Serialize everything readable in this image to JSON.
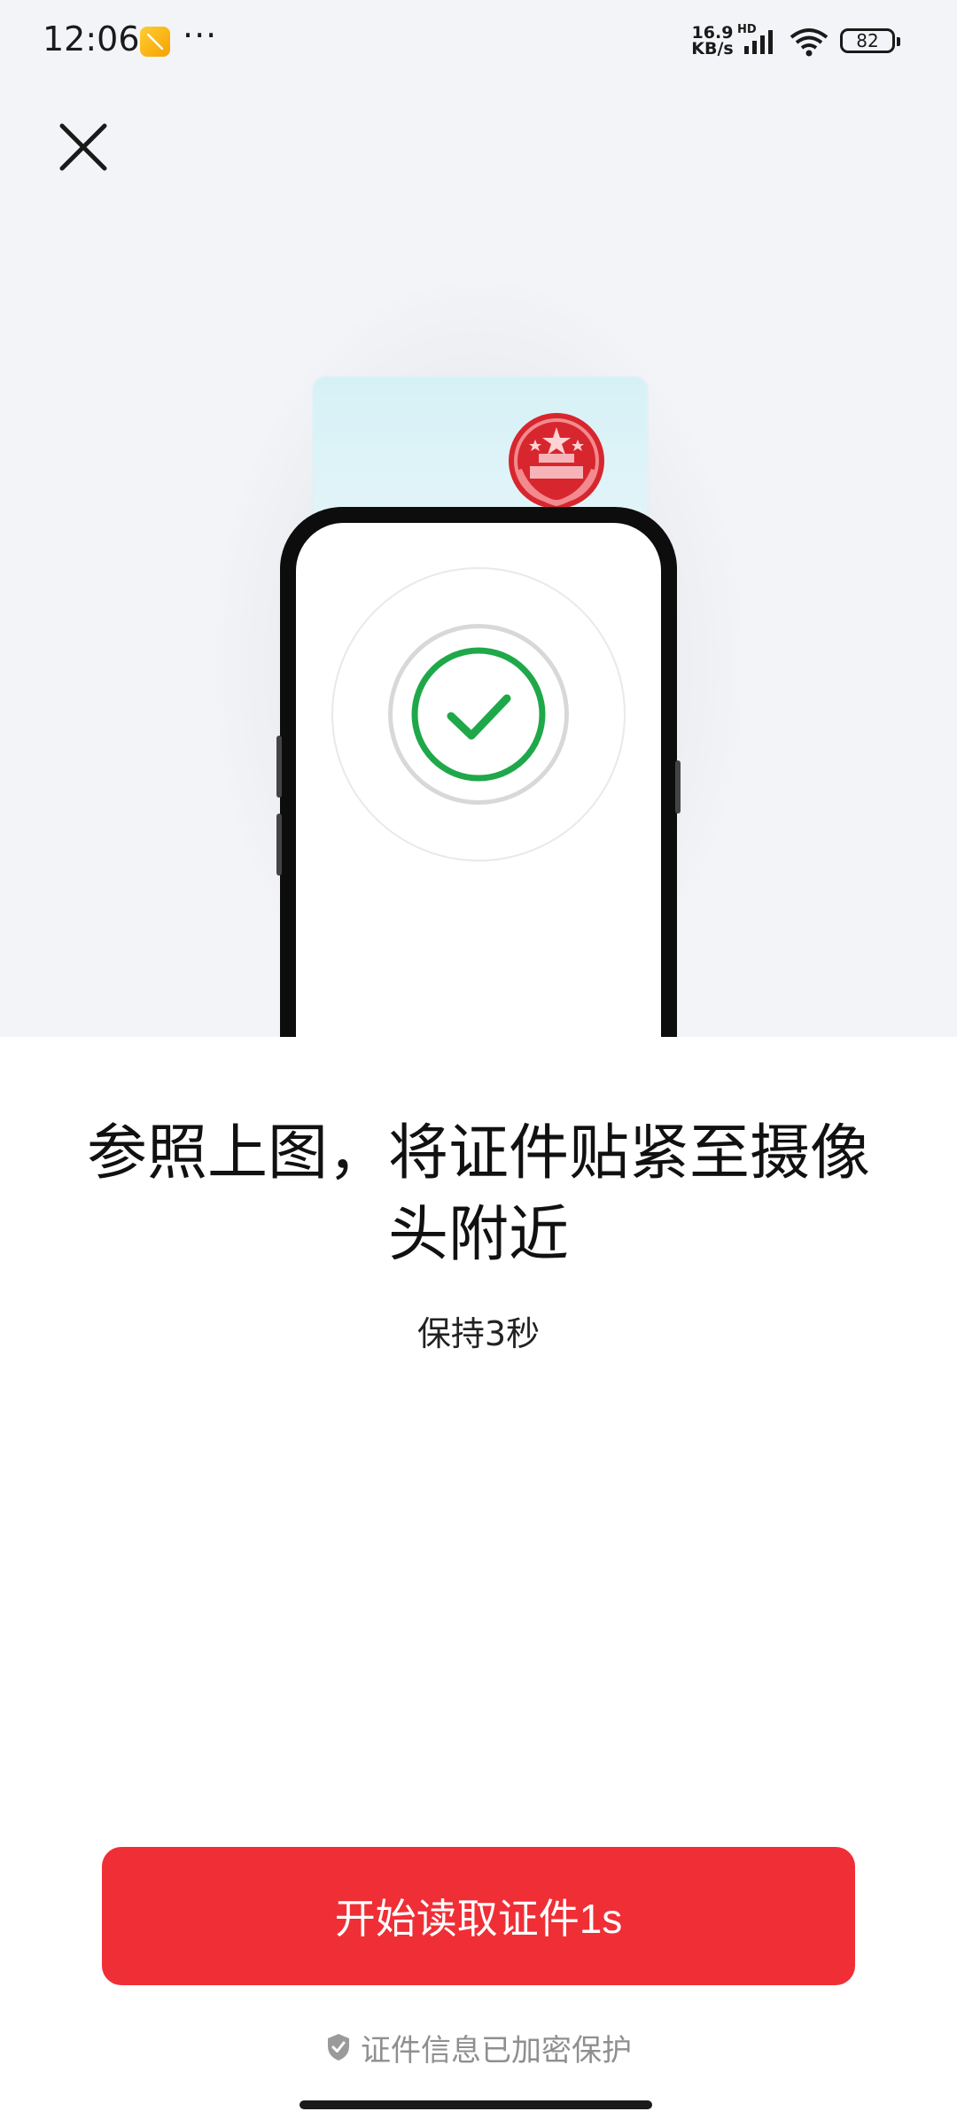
{
  "status_bar": {
    "time": "12:06",
    "more": "···",
    "net_speed": "16.9",
    "net_unit": "KB/s",
    "hd": "HD",
    "battery": "82"
  },
  "illustration": {
    "check_color": "#1fa84a",
    "emblem_color": "#d8262e"
  },
  "instruction": {
    "title": "参照上图，将证件贴紧至摄像头附近",
    "subtitle": "保持3秒"
  },
  "actions": {
    "start_button_label": "开始读取证件1s",
    "button_color": "#f02e36"
  },
  "footer": {
    "privacy_note": "证件信息已加密保护"
  },
  "icons": {
    "close": "close-icon",
    "check": "check-circle-icon",
    "shield": "shield-check-icon",
    "emblem": "national-emblem-icon"
  }
}
